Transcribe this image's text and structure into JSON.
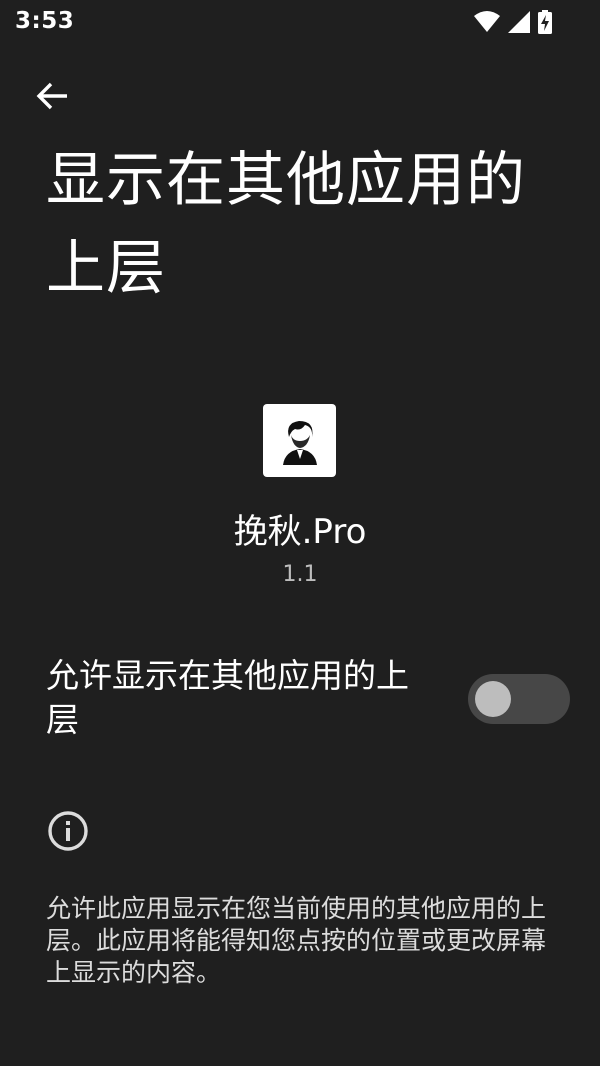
{
  "status_bar": {
    "time": "3:53",
    "icons": [
      "wifi-icon",
      "cell-signal-icon",
      "battery-charging-icon"
    ]
  },
  "header": {
    "back_icon": "arrow-back-icon",
    "title": "显示在其他应用的上层"
  },
  "app": {
    "name": "挽秋.Pro",
    "version": "1.1",
    "icon": "app-icon"
  },
  "permission": {
    "label": "允许显示在其他应用的上层",
    "enabled": false
  },
  "info": {
    "icon": "info-icon",
    "description": "允许此应用显示在您当前使用的其他应用的上层。此应用将能得知您点按的位置或更改屏幕上显示的内容。"
  },
  "colors": {
    "background": "#1f1f1f",
    "switch_track_off": "#474747",
    "switch_thumb_off": "#bdbdbd"
  }
}
